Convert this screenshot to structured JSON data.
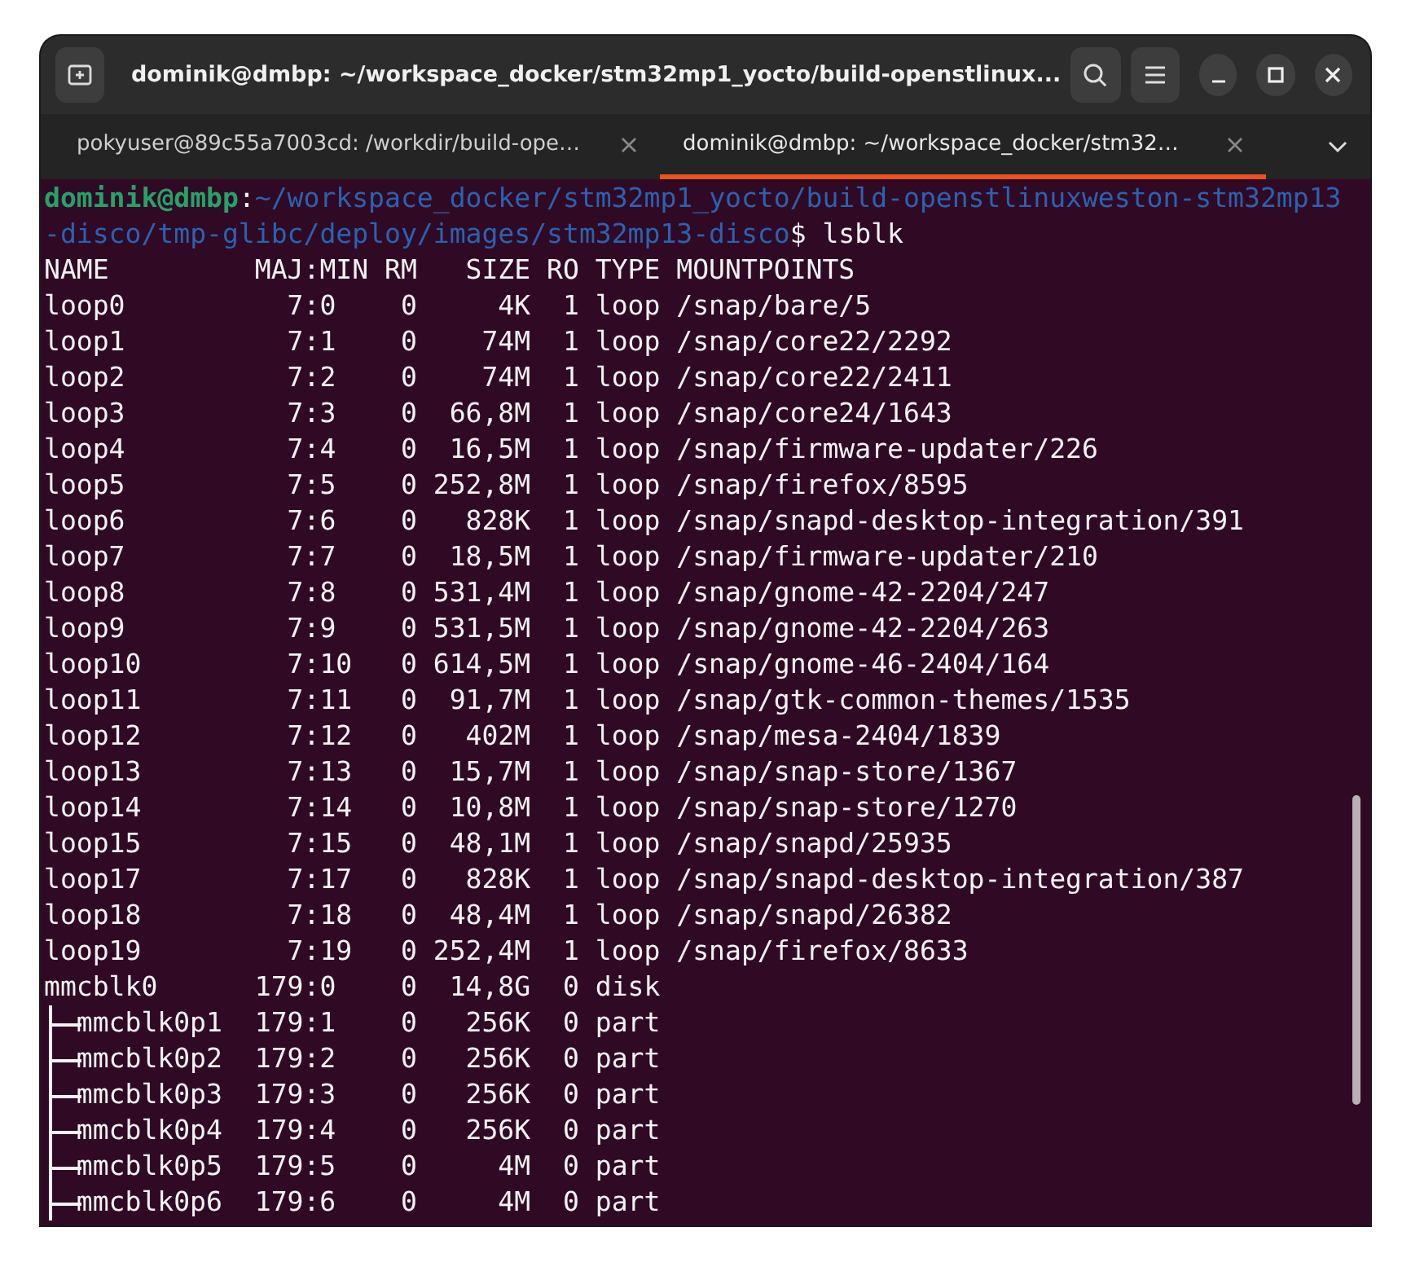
{
  "window": {
    "title": "dominik@dmbp: ~/workspace_docker/stm32mp1_yocto/build-openstlinux..."
  },
  "tabs": [
    {
      "label": "pokyuser@89c55a7003cd: /workdir/build-ope…",
      "selected": false
    },
    {
      "label": "dominik@dmbp: ~/workspace_docker/stm32…",
      "selected": true
    }
  ],
  "terminal": {
    "prompt": {
      "user_host": "dominik@dmbp",
      "separator": ":",
      "path": "~/workspace_docker/stm32mp1_yocto/build-openstlinuxweston-stm32mp13-disco/tmp-glibc/deploy/images/stm32mp13-disco",
      "symbol": "$",
      "command": " lsblk"
    },
    "columns": [
      "NAME",
      "MAJ:MIN",
      "RM",
      "SIZE",
      "RO",
      "TYPE",
      "MOUNTPOINTS"
    ],
    "rows": [
      {
        "name": "loop0",
        "majmin": "7:0",
        "rm": "0",
        "size": "4K",
        "ro": "1",
        "type": "loop",
        "mountpoint": "/snap/bare/5"
      },
      {
        "name": "loop1",
        "majmin": "7:1",
        "rm": "0",
        "size": "74M",
        "ro": "1",
        "type": "loop",
        "mountpoint": "/snap/core22/2292"
      },
      {
        "name": "loop2",
        "majmin": "7:2",
        "rm": "0",
        "size": "74M",
        "ro": "1",
        "type": "loop",
        "mountpoint": "/snap/core22/2411"
      },
      {
        "name": "loop3",
        "majmin": "7:3",
        "rm": "0",
        "size": "66,8M",
        "ro": "1",
        "type": "loop",
        "mountpoint": "/snap/core24/1643"
      },
      {
        "name": "loop4",
        "majmin": "7:4",
        "rm": "0",
        "size": "16,5M",
        "ro": "1",
        "type": "loop",
        "mountpoint": "/snap/firmware-updater/226"
      },
      {
        "name": "loop5",
        "majmin": "7:5",
        "rm": "0",
        "size": "252,8M",
        "ro": "1",
        "type": "loop",
        "mountpoint": "/snap/firefox/8595"
      },
      {
        "name": "loop6",
        "majmin": "7:6",
        "rm": "0",
        "size": "828K",
        "ro": "1",
        "type": "loop",
        "mountpoint": "/snap/snapd-desktop-integration/391"
      },
      {
        "name": "loop7",
        "majmin": "7:7",
        "rm": "0",
        "size": "18,5M",
        "ro": "1",
        "type": "loop",
        "mountpoint": "/snap/firmware-updater/210"
      },
      {
        "name": "loop8",
        "majmin": "7:8",
        "rm": "0",
        "size": "531,4M",
        "ro": "1",
        "type": "loop",
        "mountpoint": "/snap/gnome-42-2204/247"
      },
      {
        "name": "loop9",
        "majmin": "7:9",
        "rm": "0",
        "size": "531,5M",
        "ro": "1",
        "type": "loop",
        "mountpoint": "/snap/gnome-42-2204/263"
      },
      {
        "name": "loop10",
        "majmin": "7:10",
        "rm": "0",
        "size": "614,5M",
        "ro": "1",
        "type": "loop",
        "mountpoint": "/snap/gnome-46-2404/164"
      },
      {
        "name": "loop11",
        "majmin": "7:11",
        "rm": "0",
        "size": "91,7M",
        "ro": "1",
        "type": "loop",
        "mountpoint": "/snap/gtk-common-themes/1535"
      },
      {
        "name": "loop12",
        "majmin": "7:12",
        "rm": "0",
        "size": "402M",
        "ro": "1",
        "type": "loop",
        "mountpoint": "/snap/mesa-2404/1839"
      },
      {
        "name": "loop13",
        "majmin": "7:13",
        "rm": "0",
        "size": "15,7M",
        "ro": "1",
        "type": "loop",
        "mountpoint": "/snap/snap-store/1367"
      },
      {
        "name": "loop14",
        "majmin": "7:14",
        "rm": "0",
        "size": "10,8M",
        "ro": "1",
        "type": "loop",
        "mountpoint": "/snap/snap-store/1270"
      },
      {
        "name": "loop15",
        "majmin": "7:15",
        "rm": "0",
        "size": "48,1M",
        "ro": "1",
        "type": "loop",
        "mountpoint": "/snap/snapd/25935"
      },
      {
        "name": "loop17",
        "majmin": "7:17",
        "rm": "0",
        "size": "828K",
        "ro": "1",
        "type": "loop",
        "mountpoint": "/snap/snapd-desktop-integration/387"
      },
      {
        "name": "loop18",
        "majmin": "7:18",
        "rm": "0",
        "size": "48,4M",
        "ro": "1",
        "type": "loop",
        "mountpoint": "/snap/snapd/26382"
      },
      {
        "name": "loop19",
        "majmin": "7:19",
        "rm": "0",
        "size": "252,4M",
        "ro": "1",
        "type": "loop",
        "mountpoint": "/snap/firefox/8633"
      },
      {
        "name": "mmcblk0",
        "majmin": "179:0",
        "rm": "0",
        "size": "14,8G",
        "ro": "0",
        "type": "disk",
        "children": [
          {
            "name": "mmcblk0p1",
            "majmin": "179:1",
            "rm": "0",
            "size": "256K",
            "ro": "0",
            "type": "part"
          },
          {
            "name": "mmcblk0p2",
            "majmin": "179:2",
            "rm": "0",
            "size": "256K",
            "ro": "0",
            "type": "part"
          },
          {
            "name": "mmcblk0p3",
            "majmin": "179:3",
            "rm": "0",
            "size": "256K",
            "ro": "0",
            "type": "part"
          },
          {
            "name": "mmcblk0p4",
            "majmin": "179:4",
            "rm": "0",
            "size": "256K",
            "ro": "0",
            "type": "part"
          },
          {
            "name": "mmcblk0p5",
            "majmin": "179:5",
            "rm": "0",
            "size": "4M",
            "ro": "0",
            "type": "part"
          },
          {
            "name": "mmcblk0p6",
            "majmin": "179:6",
            "rm": "0",
            "size": "4M",
            "ro": "0",
            "type": "part"
          }
        ]
      }
    ]
  }
}
